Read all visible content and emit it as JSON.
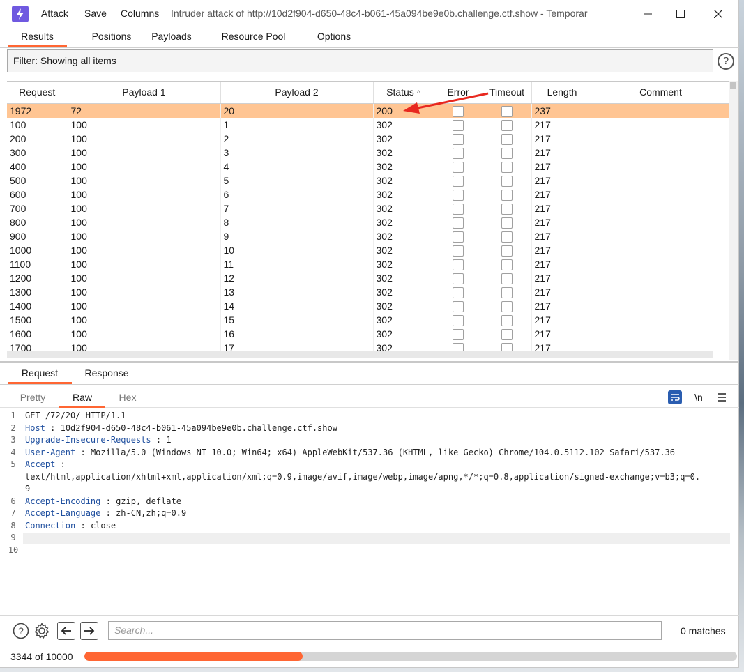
{
  "window": {
    "menu": [
      "Attack",
      "Save",
      "Columns"
    ],
    "title": "Intruder attack of http://10d2f904-d650-48c4-b061-45a094be9e0b.challenge.ctf.show - Temporar"
  },
  "tabs": [
    "Results",
    "Positions",
    "Payloads",
    "Resource Pool",
    "Options"
  ],
  "filter": {
    "text": "Filter: Showing all items"
  },
  "table": {
    "columns": [
      "Request",
      "Payload 1",
      "Payload 2",
      "Status",
      "Error",
      "Timeout",
      "Length",
      "Comment"
    ],
    "sort_column": "Status",
    "rows": [
      {
        "request": "1972",
        "p1": "72",
        "p2": "20",
        "status": "200",
        "length": "237",
        "selected": true
      },
      {
        "request": "100",
        "p1": "100",
        "p2": "1",
        "status": "302",
        "length": "217"
      },
      {
        "request": "200",
        "p1": "100",
        "p2": "2",
        "status": "302",
        "length": "217"
      },
      {
        "request": "300",
        "p1": "100",
        "p2": "3",
        "status": "302",
        "length": "217"
      },
      {
        "request": "400",
        "p1": "100",
        "p2": "4",
        "status": "302",
        "length": "217"
      },
      {
        "request": "500",
        "p1": "100",
        "p2": "5",
        "status": "302",
        "length": "217"
      },
      {
        "request": "600",
        "p1": "100",
        "p2": "6",
        "status": "302",
        "length": "217"
      },
      {
        "request": "700",
        "p1": "100",
        "p2": "7",
        "status": "302",
        "length": "217"
      },
      {
        "request": "800",
        "p1": "100",
        "p2": "8",
        "status": "302",
        "length": "217"
      },
      {
        "request": "900",
        "p1": "100",
        "p2": "9",
        "status": "302",
        "length": "217"
      },
      {
        "request": "1000",
        "p1": "100",
        "p2": "10",
        "status": "302",
        "length": "217"
      },
      {
        "request": "1100",
        "p1": "100",
        "p2": "11",
        "status": "302",
        "length": "217"
      },
      {
        "request": "1200",
        "p1": "100",
        "p2": "12",
        "status": "302",
        "length": "217"
      },
      {
        "request": "1300",
        "p1": "100",
        "p2": "13",
        "status": "302",
        "length": "217"
      },
      {
        "request": "1400",
        "p1": "100",
        "p2": "14",
        "status": "302",
        "length": "217"
      },
      {
        "request": "1500",
        "p1": "100",
        "p2": "15",
        "status": "302",
        "length": "217"
      },
      {
        "request": "1600",
        "p1": "100",
        "p2": "16",
        "status": "302",
        "length": "217"
      },
      {
        "request": "1700",
        "p1": "100",
        "p2": "17",
        "status": "302",
        "length": "217"
      }
    ]
  },
  "detail_tabs": [
    "Request",
    "Response"
  ],
  "view_tabs": [
    "Pretty",
    "Raw",
    "Hex"
  ],
  "newline_toggle": "\\n",
  "request_lines": [
    {
      "n": "1",
      "key": "",
      "sep": "",
      "val": "GET /72/20/ HTTP/1.1"
    },
    {
      "n": "2",
      "key": "Host",
      "sep": " : ",
      "val": "10d2f904-d650-48c4-b061-45a094be9e0b.challenge.ctf.show"
    },
    {
      "n": "3",
      "key": "Upgrade-Insecure-Requests",
      "sep": " : ",
      "val": "1"
    },
    {
      "n": "4",
      "key": "User-Agent",
      "sep": " : ",
      "val": "Mozilla/5.0 (Windows NT 10.0; Win64; x64) AppleWebKit/537.36 (KHTML, like Gecko) Chrome/104.0.5112.102 Safari/537.36"
    },
    {
      "n": "5",
      "key": "Accept",
      "sep": " :",
      "val": ""
    },
    {
      "n": "",
      "key": "",
      "sep": "",
      "val": "text/html,application/xhtml+xml,application/xml;q=0.9,image/avif,image/webp,image/apng,*/*;q=0.8,application/signed-exchange;v=b3;q=0."
    },
    {
      "n": "",
      "key": "",
      "sep": "",
      "val": "9"
    },
    {
      "n": "6",
      "key": "Accept-Encoding",
      "sep": " : ",
      "val": "gzip, deflate"
    },
    {
      "n": "7",
      "key": "Accept-Language",
      "sep": " : ",
      "val": "zh-CN,zh;q=0.9"
    },
    {
      "n": "8",
      "key": "Connection",
      "sep": " : ",
      "val": "close"
    },
    {
      "n": "9",
      "key": "",
      "sep": "",
      "val": ""
    },
    {
      "n": "10",
      "key": "",
      "sep": "",
      "val": ""
    }
  ],
  "search": {
    "placeholder": "Search...",
    "matches": "0 matches"
  },
  "progress": {
    "label": "3344 of 10000",
    "fraction": 0.3344
  },
  "colors": {
    "accent": "#ff6633",
    "selected_row": "#ffc593",
    "header_key": "#1f4f9f",
    "app_icon": "#6f59e0"
  }
}
